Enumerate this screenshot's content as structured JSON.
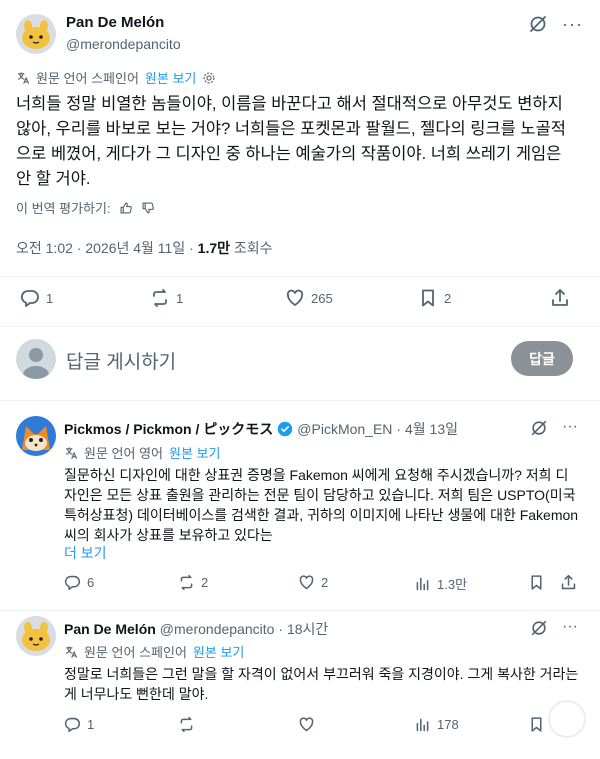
{
  "main_tweet": {
    "author_name": "Pan De Melón",
    "author_handle": "@merondepancito",
    "translation_note": "원문 언어 스페인어",
    "show_original": "원본 보기",
    "text": "너희들 정말 비열한 놈들이야, 이름을 바꾼다고 해서 절대적으로 아무것도 변하지 않아, 우리를 바보로 보는 거야? 너희들은 포켓몬과 팔월드, 젤다의 링크를 노골적으로 베꼈어, 게다가 그 디자인 중 하나는 예술가의 작품이야. 너희 쓰레기 게임은 안 할 거야.",
    "rate_translation": "이 번역 평가하기:",
    "timestamp": "오전 1:02 · 2026년 4월 11일 · ",
    "views_count": "1.7만",
    "views_label": " 조회수",
    "replies": "1",
    "retweets": "1",
    "likes": "265",
    "bookmarks": "2"
  },
  "reply_box": {
    "placeholder": "답글 게시하기",
    "button": "답글"
  },
  "replies": [
    {
      "author_name": "Pickmos / Pickmon / ピックモス",
      "author_handle": "@PickMon_EN",
      "time": "· 4월 13일",
      "translation_note": "원문 언어 영어",
      "show_original": "원본 보기",
      "text": "질문하신 디자인에 대한 상표권 증명을 Fakemon 씨에게 요청해 주시겠습니까? 저희 디자인은 모든 상표 출원을 관리하는 전문 팀이 담당하고 있습니다. 저희 팀은 USPTO(미국 특허상표청) 데이터베이스를 검색한 결과, 귀하의 이미지에 나타난 생물에 대한 Fakemon 씨의 회사가 상표를 보유하고 있다는",
      "show_more": "더 보기",
      "replies": "6",
      "retweets": "2",
      "likes": "2",
      "views": "1.3만"
    },
    {
      "author_name": "Pan De Melón",
      "author_handle": "@merondepancito",
      "time": "· 18시간",
      "translation_note": "원문 언어 스페인어",
      "show_original": "원본 보기",
      "text": "정말로 너희들은 그런 말을 할 자격이 없어서 부끄러워 죽을 지경이야. 그게 복사한 거라는 게 너무나도 뻔한데 말야.",
      "replies": "1",
      "retweets": "",
      "likes": "",
      "views": "178"
    }
  ],
  "colors": {
    "accent": "#1d9bf0",
    "muted": "#536471",
    "text": "#0f1419",
    "reply_button": "#8b9197"
  }
}
